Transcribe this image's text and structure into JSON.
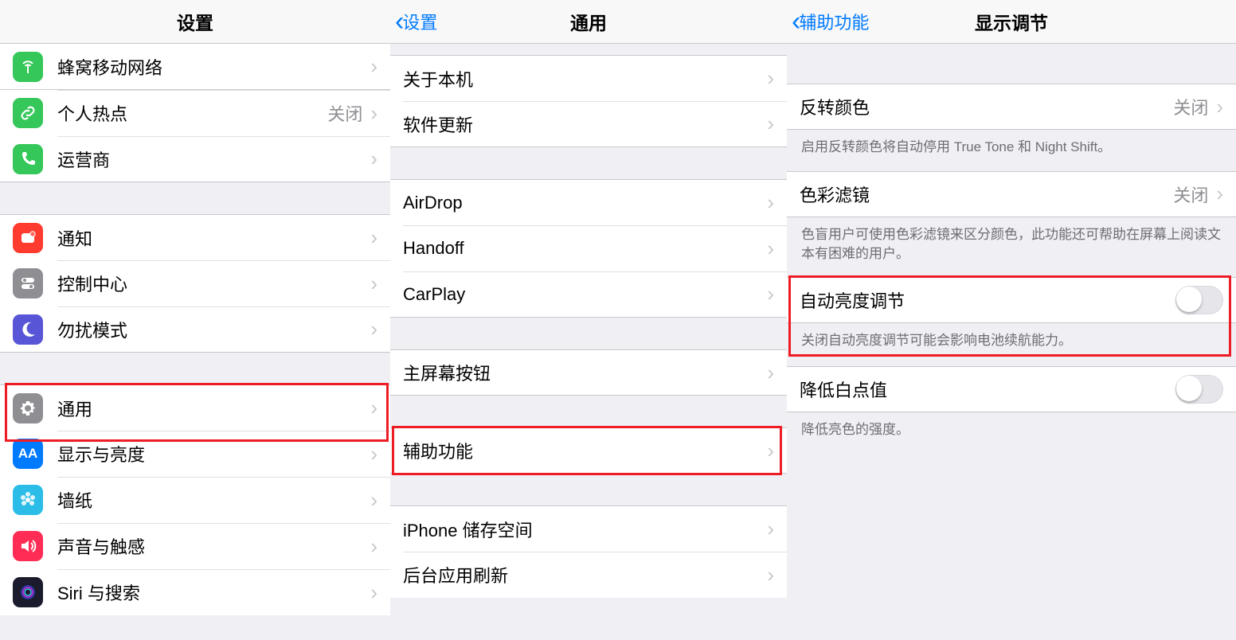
{
  "panel1": {
    "title": "设置",
    "group1": [
      {
        "key": "cellular",
        "label": "蜂窝移动网络",
        "detail": ""
      },
      {
        "key": "hotspot",
        "label": "个人热点",
        "detail": "关闭"
      },
      {
        "key": "carrier",
        "label": "运营商",
        "detail": ""
      }
    ],
    "group2": [
      {
        "key": "notifications",
        "label": "通知"
      },
      {
        "key": "control-center",
        "label": "控制中心"
      },
      {
        "key": "dnd",
        "label": "勿扰模式"
      }
    ],
    "group3": [
      {
        "key": "general",
        "label": "通用",
        "highlight": true
      },
      {
        "key": "display",
        "label": "显示与亮度"
      },
      {
        "key": "wallpaper",
        "label": "墙纸"
      },
      {
        "key": "sound",
        "label": "声音与触感"
      },
      {
        "key": "siri",
        "label": "Siri 与搜索"
      }
    ]
  },
  "panel2": {
    "back": "设置",
    "title": "通用",
    "group1": [
      {
        "key": "about",
        "label": "关于本机"
      },
      {
        "key": "software-update",
        "label": "软件更新"
      }
    ],
    "group2": [
      {
        "key": "airdrop",
        "label": "AirDrop"
      },
      {
        "key": "handoff",
        "label": "Handoff"
      },
      {
        "key": "carplay",
        "label": "CarPlay"
      }
    ],
    "group3": [
      {
        "key": "home-button",
        "label": "主屏幕按钮"
      }
    ],
    "group4": [
      {
        "key": "accessibility",
        "label": "辅助功能",
        "highlight": true
      }
    ],
    "group5": [
      {
        "key": "storage",
        "label": "iPhone 储存空间"
      },
      {
        "key": "background-refresh",
        "label": "后台应用刷新"
      }
    ]
  },
  "panel3": {
    "back": "辅助功能",
    "title": "显示调节",
    "rows": {
      "invert": {
        "label": "反转颜色",
        "detail": "关闭"
      },
      "invert_footer": "启用反转颜色将自动停用 True Tone 和 Night Shift。",
      "color_filter": {
        "label": "色彩滤镜",
        "detail": "关闭"
      },
      "color_filter_footer": "色盲用户可使用色彩滤镜来区分颜色，此功能还可帮助在屏幕上阅读文本有困难的用户。",
      "auto_brightness": {
        "label": "自动亮度调节",
        "on": false
      },
      "auto_brightness_footer": "关闭自动亮度调节可能会影响电池续航能力。",
      "reduce_white": {
        "label": "降低白点值",
        "on": false
      },
      "reduce_white_footer": "降低亮色的强度。"
    }
  }
}
